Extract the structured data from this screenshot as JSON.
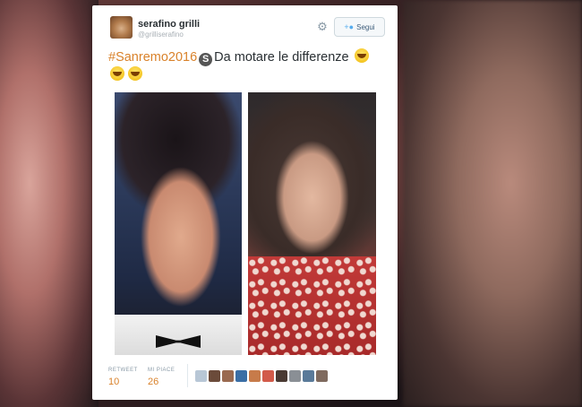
{
  "tweet": {
    "user_name": "serafino grilli",
    "user_handle": "@grilliserafino",
    "follow_label": "Segui",
    "hashtag": "#Sanremo2016",
    "s_badge": "S",
    "text": "Da motare le differenze",
    "stats": [
      {
        "label": "RETWEET",
        "value": "10"
      },
      {
        "label": "MI PIACE",
        "value": "26"
      }
    ]
  },
  "icons": {
    "settings": "gear-icon",
    "follow": "person-add-icon",
    "emoji": "grinning-sweat-face-emoji"
  },
  "colors": {
    "hashtag": "#d9822b",
    "stat_value": "#d9822b",
    "follow_text": "#3b5b79"
  }
}
